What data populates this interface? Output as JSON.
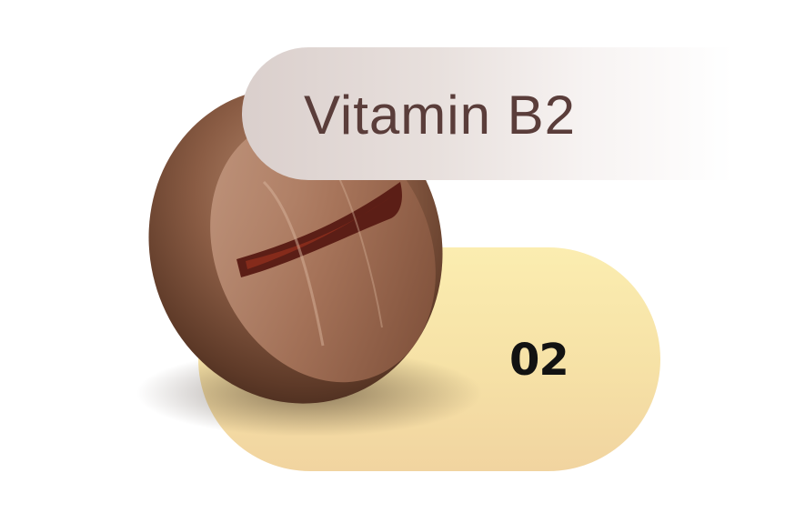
{
  "label": "Vitamin B2",
  "number": "02",
  "colors": {
    "label_text": "#5a3d3a",
    "label_pill": "#dacfcc",
    "number_pill": "#f6e1a6",
    "number_text": "#121212",
    "bean_dark": "#4a2a1c",
    "bean_light": "#b98c6f"
  },
  "illustration": "coffee-bean-icon"
}
